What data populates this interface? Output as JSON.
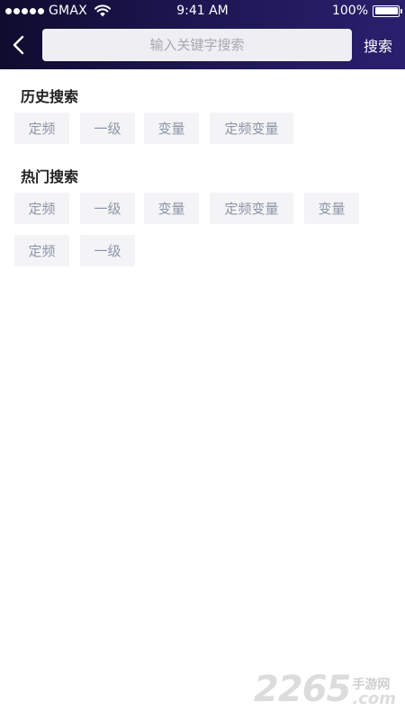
{
  "status_bar": {
    "carrier": "GMAX",
    "time": "9:41 AM",
    "battery": "100%",
    "battery_level": 1.0
  },
  "nav": {
    "back_icon": "chevron-left-icon",
    "search_placeholder": "输入关键字搜索",
    "search_value": "",
    "search_button": "搜索"
  },
  "history": {
    "title": "历史搜索",
    "tags": [
      "定频",
      "一级",
      "变量",
      "定频变量"
    ]
  },
  "hot": {
    "title": "热门搜索",
    "tags": [
      "定频",
      "一级",
      "变量",
      "定频变量",
      "变量",
      "定频",
      "一级"
    ]
  },
  "watermark": {
    "number": "2265",
    "chinese": "手游网",
    "suffix": ".com"
  },
  "colors": {
    "header_start": "#0f0c2f",
    "header_end": "#2a1f6e",
    "tag_bg": "#f4f4f6",
    "tag_text": "#8b95a8"
  }
}
